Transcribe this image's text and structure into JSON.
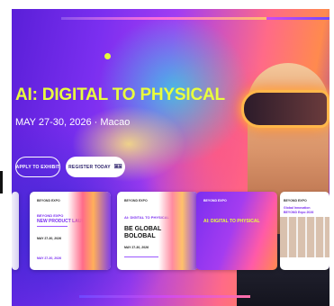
{
  "hero": {
    "headline": "AI: DIGITAL TO PHYSICAL",
    "dateline": "MAY 27-30, 2026 · Macao",
    "accent_color": "#e9ff3c"
  },
  "buttons": {
    "apply_label": "APPLY TO EXHIBIT",
    "register_label": "REGISTER TODAY",
    "register_icon": "ticket-icon"
  },
  "cards": [
    {
      "tag": "BEYOND EXPO",
      "title_line1": "BEYOND EXPO",
      "title_line2": "NEW PRODUCT LAUNCH",
      "meta": "MAY 27-30, 2026",
      "foot": "MAY 27-30, 2026"
    },
    {
      "tag": "BEYOND EXPO",
      "title_line1": "AI: DIGITAL TO PHYSICAL",
      "title_line2": "BE GLOBAL",
      "title_line3": "BOLOBAL",
      "meta": "MAY 27-30, 2026"
    },
    {
      "tag": "BEYOND EXPO",
      "title_line1": "AI: DIGITAL TO PHYSICAL"
    },
    {
      "tag": "BEYOND EXPO",
      "title_line1": "Global Innovation",
      "title_line2": "BEYOND Expo 2026"
    }
  ]
}
